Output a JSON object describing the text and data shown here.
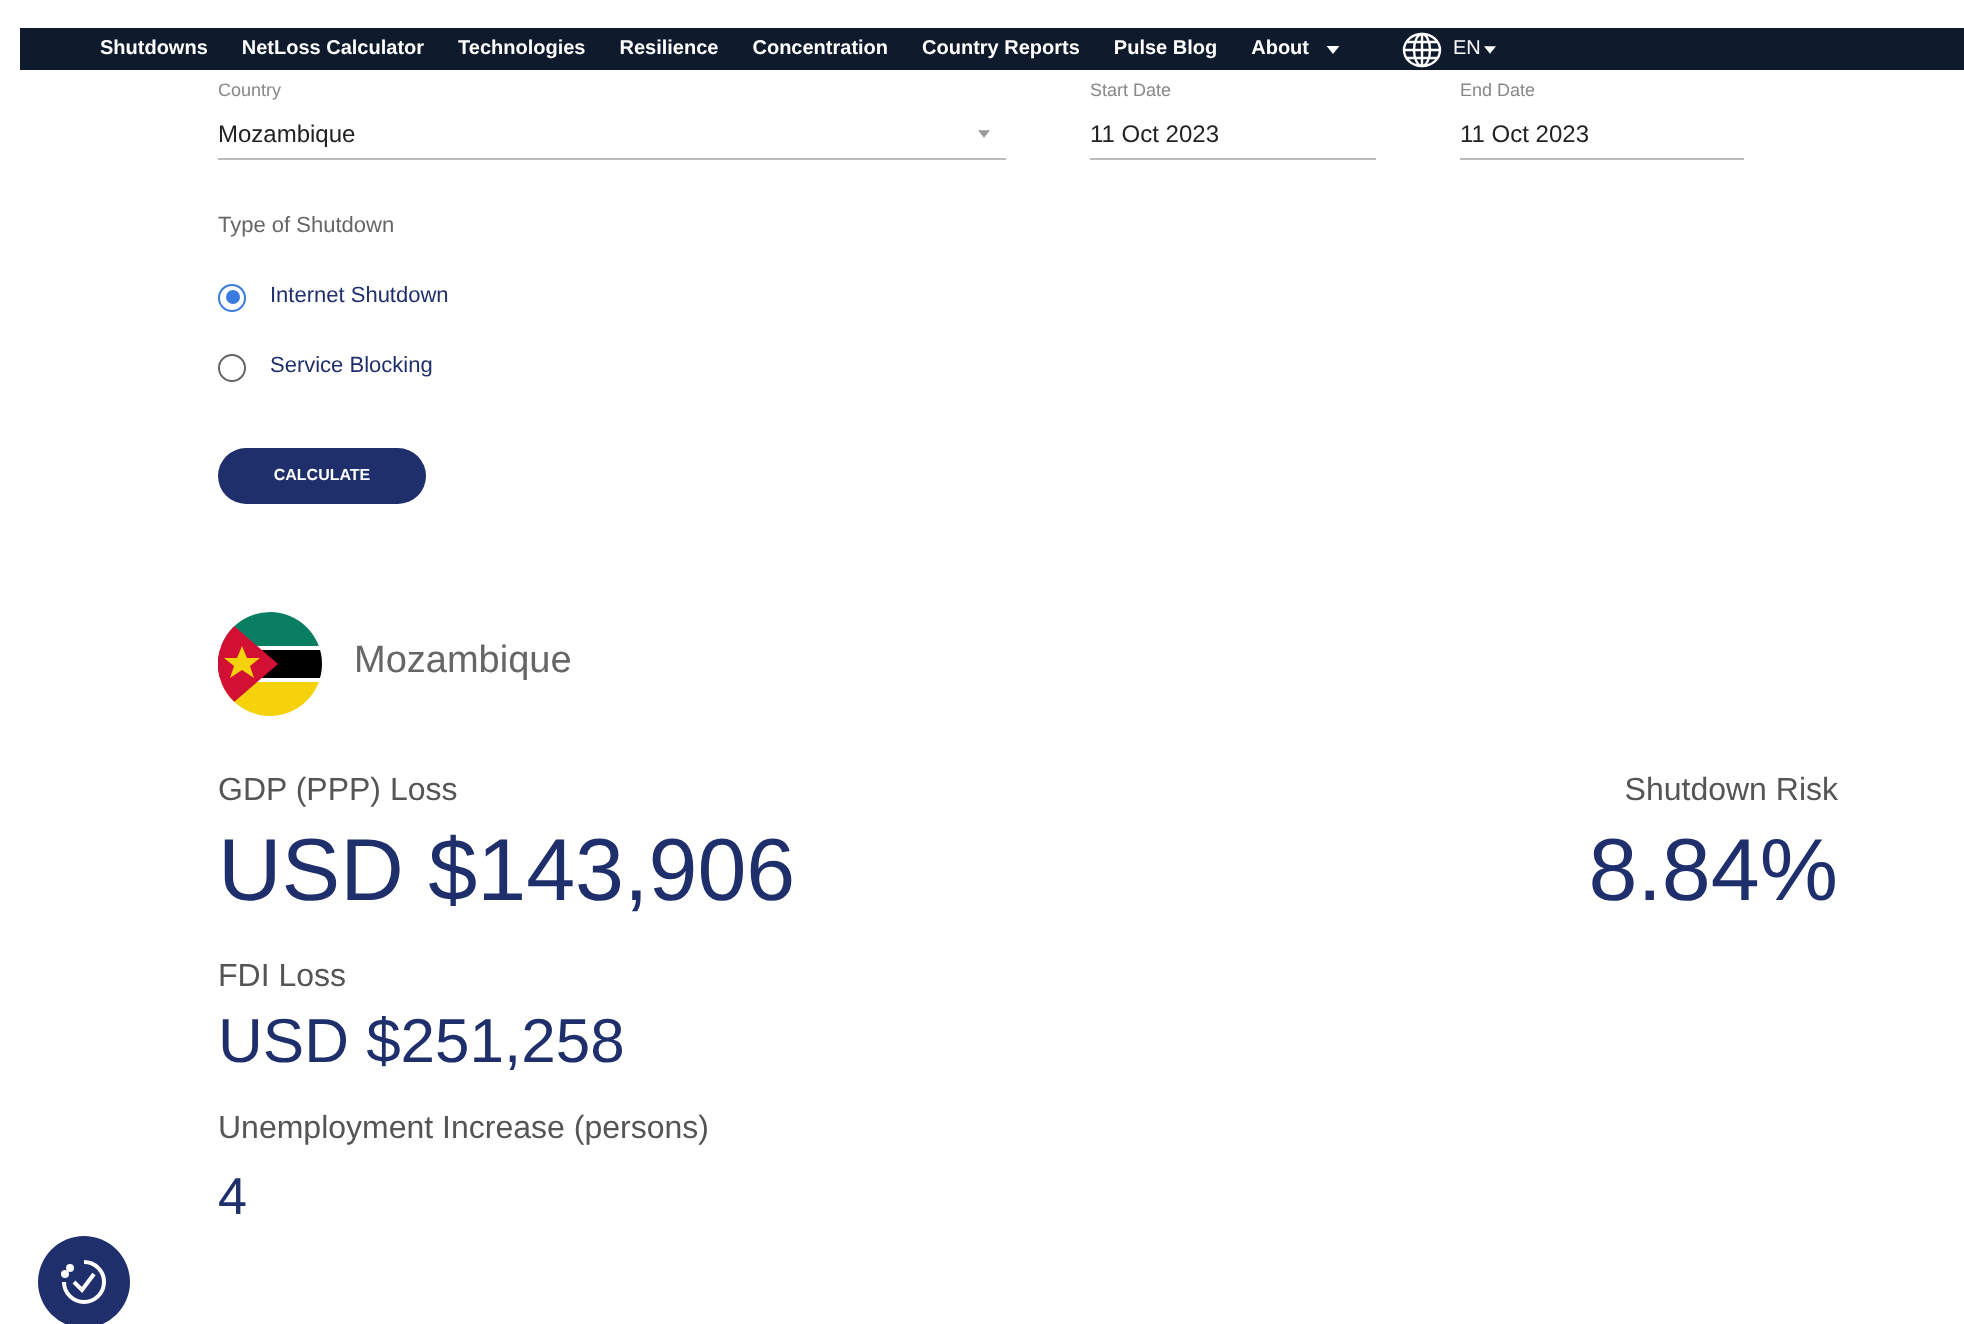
{
  "nav": {
    "items": [
      {
        "label": "Shutdowns",
        "kind": "link"
      },
      {
        "label": "NetLoss Calculator",
        "kind": "link"
      },
      {
        "label": "Technologies",
        "kind": "link"
      },
      {
        "label": "Resilience",
        "kind": "link"
      },
      {
        "label": "Concentration",
        "kind": "link"
      },
      {
        "label": "Country Reports",
        "kind": "link"
      },
      {
        "label": "Pulse Blog",
        "kind": "link"
      },
      {
        "label": "About",
        "kind": "dropdown"
      }
    ],
    "language": "EN"
  },
  "form": {
    "country": {
      "label": "Country",
      "value": "Mozambique"
    },
    "start_date": {
      "label": "Start Date",
      "value": "11 Oct 2023"
    },
    "end_date": {
      "label": "End Date",
      "value": "11 Oct 2023"
    },
    "type_label": "Type of Shutdown",
    "types": [
      {
        "label": "Internet Shutdown",
        "selected": true
      },
      {
        "label": "Service Blocking",
        "selected": false
      }
    ],
    "button": "CALCULATE"
  },
  "result": {
    "country": "Mozambique",
    "gdp_label": "GDP (PPP) Loss",
    "gdp_value": "USD $143,906",
    "risk_label": "Shutdown Risk",
    "risk_value": "8.84%",
    "fdi_label": "FDI Loss",
    "fdi_value": "USD $251,258",
    "unemployment_label": "Unemployment Increase (persons)",
    "unemployment_value": "4"
  }
}
